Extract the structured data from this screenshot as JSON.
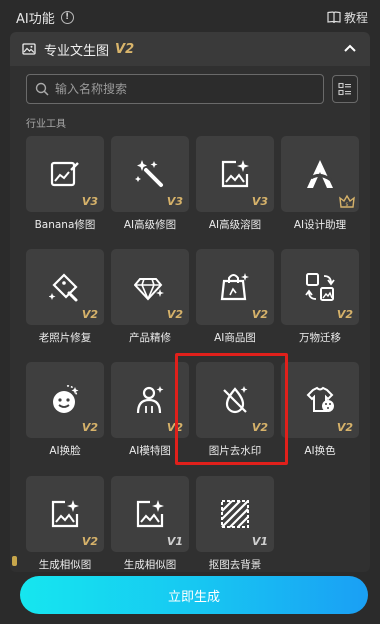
{
  "topbar": {
    "title": "AI功能",
    "tutorial": "教程"
  },
  "panel": {
    "header_label": "专业文生图",
    "header_version": "V2",
    "search_placeholder": "输入名称搜索",
    "section_label": "行业工具"
  },
  "tools": [
    {
      "label": "Banana修图",
      "version": "V3",
      "icon": "image-edit-icon"
    },
    {
      "label": "AI高级修图",
      "version": "V3",
      "icon": "magic-wand-icon"
    },
    {
      "label": "AI高级溶图",
      "version": "V3",
      "icon": "image-sparkle-icon"
    },
    {
      "label": "AI设计助理",
      "version": "",
      "icon": "design-assistant-icon",
      "badge": "crown-icon"
    },
    {
      "label": "老照片修复",
      "version": "V2",
      "icon": "photo-restore-icon"
    },
    {
      "label": "产品精修",
      "version": "V2",
      "icon": "diamond-sparkle-icon"
    },
    {
      "label": "AI商品图",
      "version": "V2",
      "icon": "shopping-bag-icon"
    },
    {
      "label": "万物迁移",
      "version": "V2",
      "icon": "transfer-icon"
    },
    {
      "label": "AI换脸",
      "version": "V2",
      "icon": "face-swap-icon"
    },
    {
      "label": "AI模特图",
      "version": "V2",
      "icon": "model-person-icon"
    },
    {
      "label": "图片去水印",
      "version": "V2",
      "icon": "watermark-remove-icon"
    },
    {
      "label": "AI换色",
      "version": "V2",
      "icon": "color-change-icon"
    },
    {
      "label": "生成相似图",
      "version": "V2",
      "icon": "similar-image-icon"
    },
    {
      "label": "生成相似图",
      "version": "V1",
      "icon": "similar-image-icon"
    },
    {
      "label": "抠图去背景",
      "version": "V1",
      "icon": "background-remove-icon"
    }
  ],
  "generate_button": "立即生成",
  "colors": {
    "accent_gold": "#d6b26a",
    "highlight_red": "#e0201b",
    "button_cyan": "#17c8f2"
  }
}
